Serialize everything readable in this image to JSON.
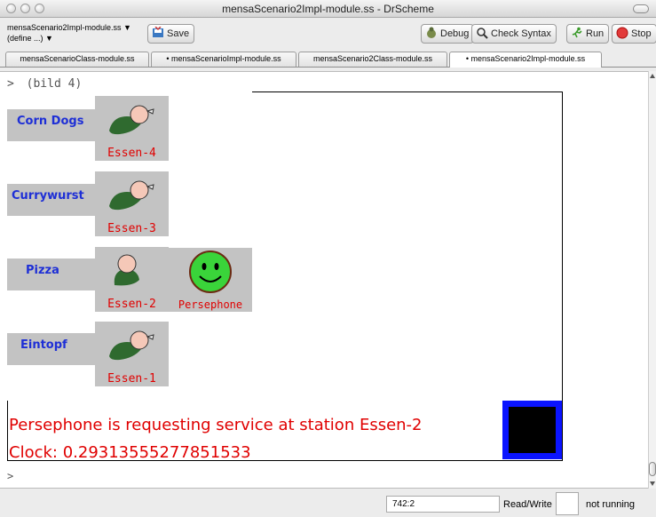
{
  "window": {
    "title": "mensaScenario2Impl-module.ss - DrScheme"
  },
  "toolbar": {
    "file_menu_label": "mensaScenario2Impl-module.ss ▼",
    "define_menu_label": "(define ...) ▼",
    "save_label": "Save",
    "debug_label": "Debug",
    "check_syntax_label": "Check Syntax",
    "run_label": "Run",
    "stop_label": "Stop"
  },
  "tabs": [
    {
      "label": "mensaScenarioClass-module.ss"
    },
    {
      "label": "• mensaScenarioImpl-module.ss"
    },
    {
      "label": "mensaScenario2Class-module.ss"
    },
    {
      "label": "• mensaScenario2Impl-module.ss"
    }
  ],
  "repl": {
    "prompt": ">",
    "command": "(bild 4)",
    "labels": [
      {
        "text": "Corn Dogs"
      },
      {
        "text": "Currywurst"
      },
      {
        "text": "Pizza"
      },
      {
        "text": "Eintopf"
      }
    ],
    "stations": [
      {
        "name": "Essen-4"
      },
      {
        "name": "Essen-3"
      },
      {
        "name": "Essen-2"
      },
      {
        "name": "Essen-1"
      }
    ],
    "customer": {
      "name": "Persephone"
    },
    "message": "Persephone is requesting service at station Essen-2",
    "clock": "Clock: 0.29313555277851533",
    "next_prompt": ">"
  },
  "status": {
    "position": "742:2",
    "mode": "Read/Write",
    "running": "not running"
  },
  "colors": {
    "label_text": "#1e2fd6",
    "station_text": "#e00000",
    "panel_bg": "#c3c3c3",
    "box_border": "#0a14ff"
  }
}
